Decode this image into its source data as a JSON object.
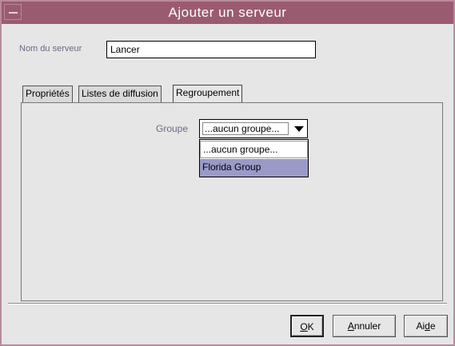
{
  "window": {
    "title": "Ajouter un serveur"
  },
  "server_name": {
    "label": "Nom du serveur",
    "value": "Lancer"
  },
  "tabs": [
    {
      "label": "Propriétés",
      "active": false
    },
    {
      "label": "Listes de diffusion",
      "active": false
    },
    {
      "label": "Regroupement",
      "active": true
    }
  ],
  "group": {
    "label": "Groupe",
    "selected_value": "...aucun groupe...",
    "options": [
      "...aucun groupe...",
      "Florida Group"
    ],
    "highlighted_option": "Florida Group"
  },
  "buttons": {
    "ok": {
      "mnemonic": "O",
      "rest": "K"
    },
    "cancel": {
      "mnemonic": "A",
      "rest": "nnuler"
    },
    "help": {
      "prefix": "Ai",
      "mnemonic": "d",
      "rest": "e"
    }
  },
  "colors": {
    "titlebar": "#9a5b70",
    "highlight": "#9a9ac9",
    "background": "#e6e6e6"
  }
}
